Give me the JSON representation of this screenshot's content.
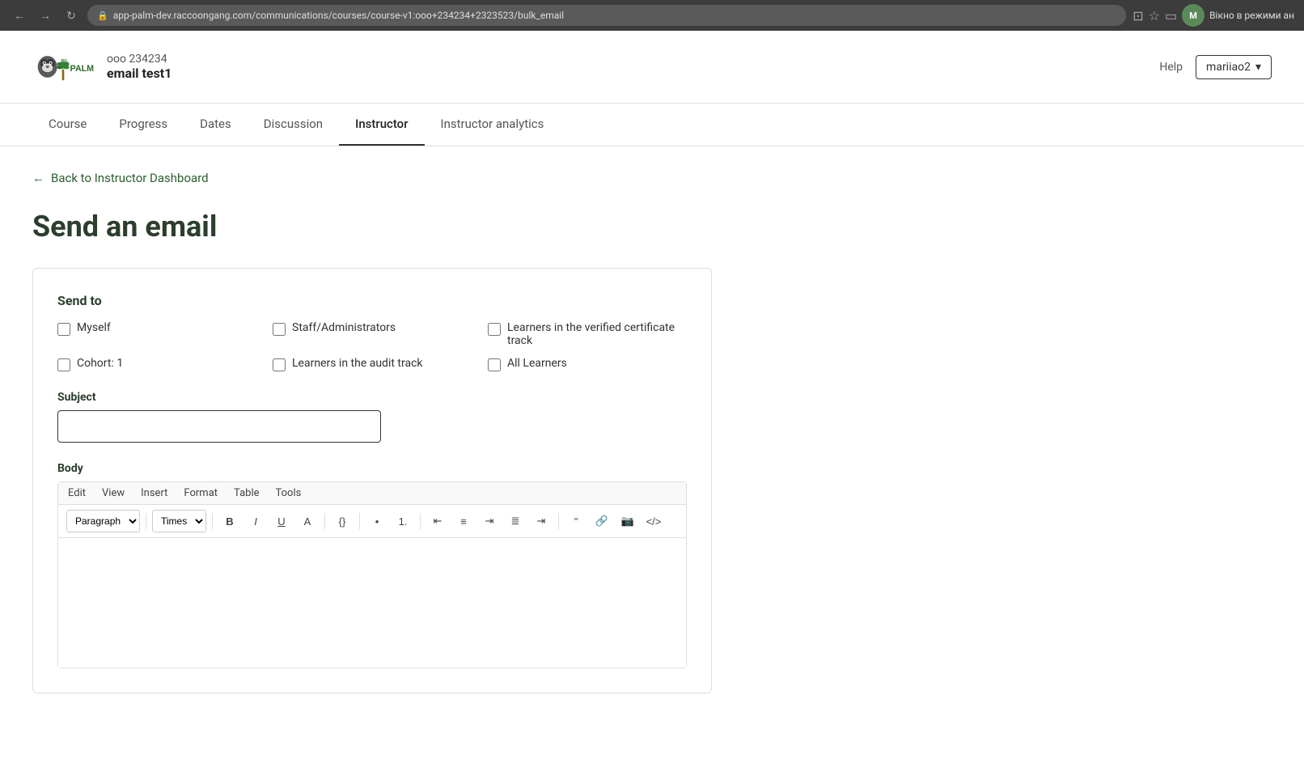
{
  "browser": {
    "url": "app-palm-dev.raccoongang.com/communications/courses/course-v1:ooo+234234+2323523/bulk_email",
    "user_label": "М",
    "window_mode": "Вікно в режими ан"
  },
  "header": {
    "course_id": "ooo 234234",
    "course_name": "email test1",
    "help_label": "Help",
    "user_name": "mariiao2",
    "user_dropdown_arrow": "▾"
  },
  "nav": {
    "tabs": [
      {
        "id": "course",
        "label": "Course",
        "active": false
      },
      {
        "id": "progress",
        "label": "Progress",
        "active": false
      },
      {
        "id": "dates",
        "label": "Dates",
        "active": false
      },
      {
        "id": "discussion",
        "label": "Discussion",
        "active": false
      },
      {
        "id": "instructor",
        "label": "Instructor",
        "active": true
      },
      {
        "id": "instructor-analytics",
        "label": "Instructor analytics",
        "active": false
      }
    ]
  },
  "back_link": "Back to Instructor Dashboard",
  "page_title": "Send an email",
  "send_to": {
    "section_title": "Send to",
    "options": [
      {
        "id": "myself",
        "label": "Myself",
        "checked": false
      },
      {
        "id": "staff",
        "label": "Staff/Administrators",
        "checked": false
      },
      {
        "id": "verified",
        "label": "Learners in the verified certificate track",
        "checked": false
      },
      {
        "id": "cohort1",
        "label": "Cohort: 1",
        "checked": false
      },
      {
        "id": "audit",
        "label": "Learners in the audit track",
        "checked": false
      },
      {
        "id": "all",
        "label": "All Learners",
        "checked": false
      }
    ]
  },
  "subject": {
    "label": "Subject",
    "placeholder": "",
    "value": ""
  },
  "body": {
    "label": "Body",
    "menu": [
      "Edit",
      "View",
      "Insert",
      "Format",
      "Table",
      "Tools"
    ],
    "toolbar": {
      "format_options": [
        "Paragraph"
      ],
      "font_options": [
        "Times"
      ],
      "buttons": [
        "B",
        "I",
        "U",
        "A",
        "{}",
        "•",
        "1.",
        "≡",
        "≡",
        "≡",
        "≡",
        "≡",
        "\"",
        "🔗",
        "🖼",
        "</>"
      ]
    }
  }
}
